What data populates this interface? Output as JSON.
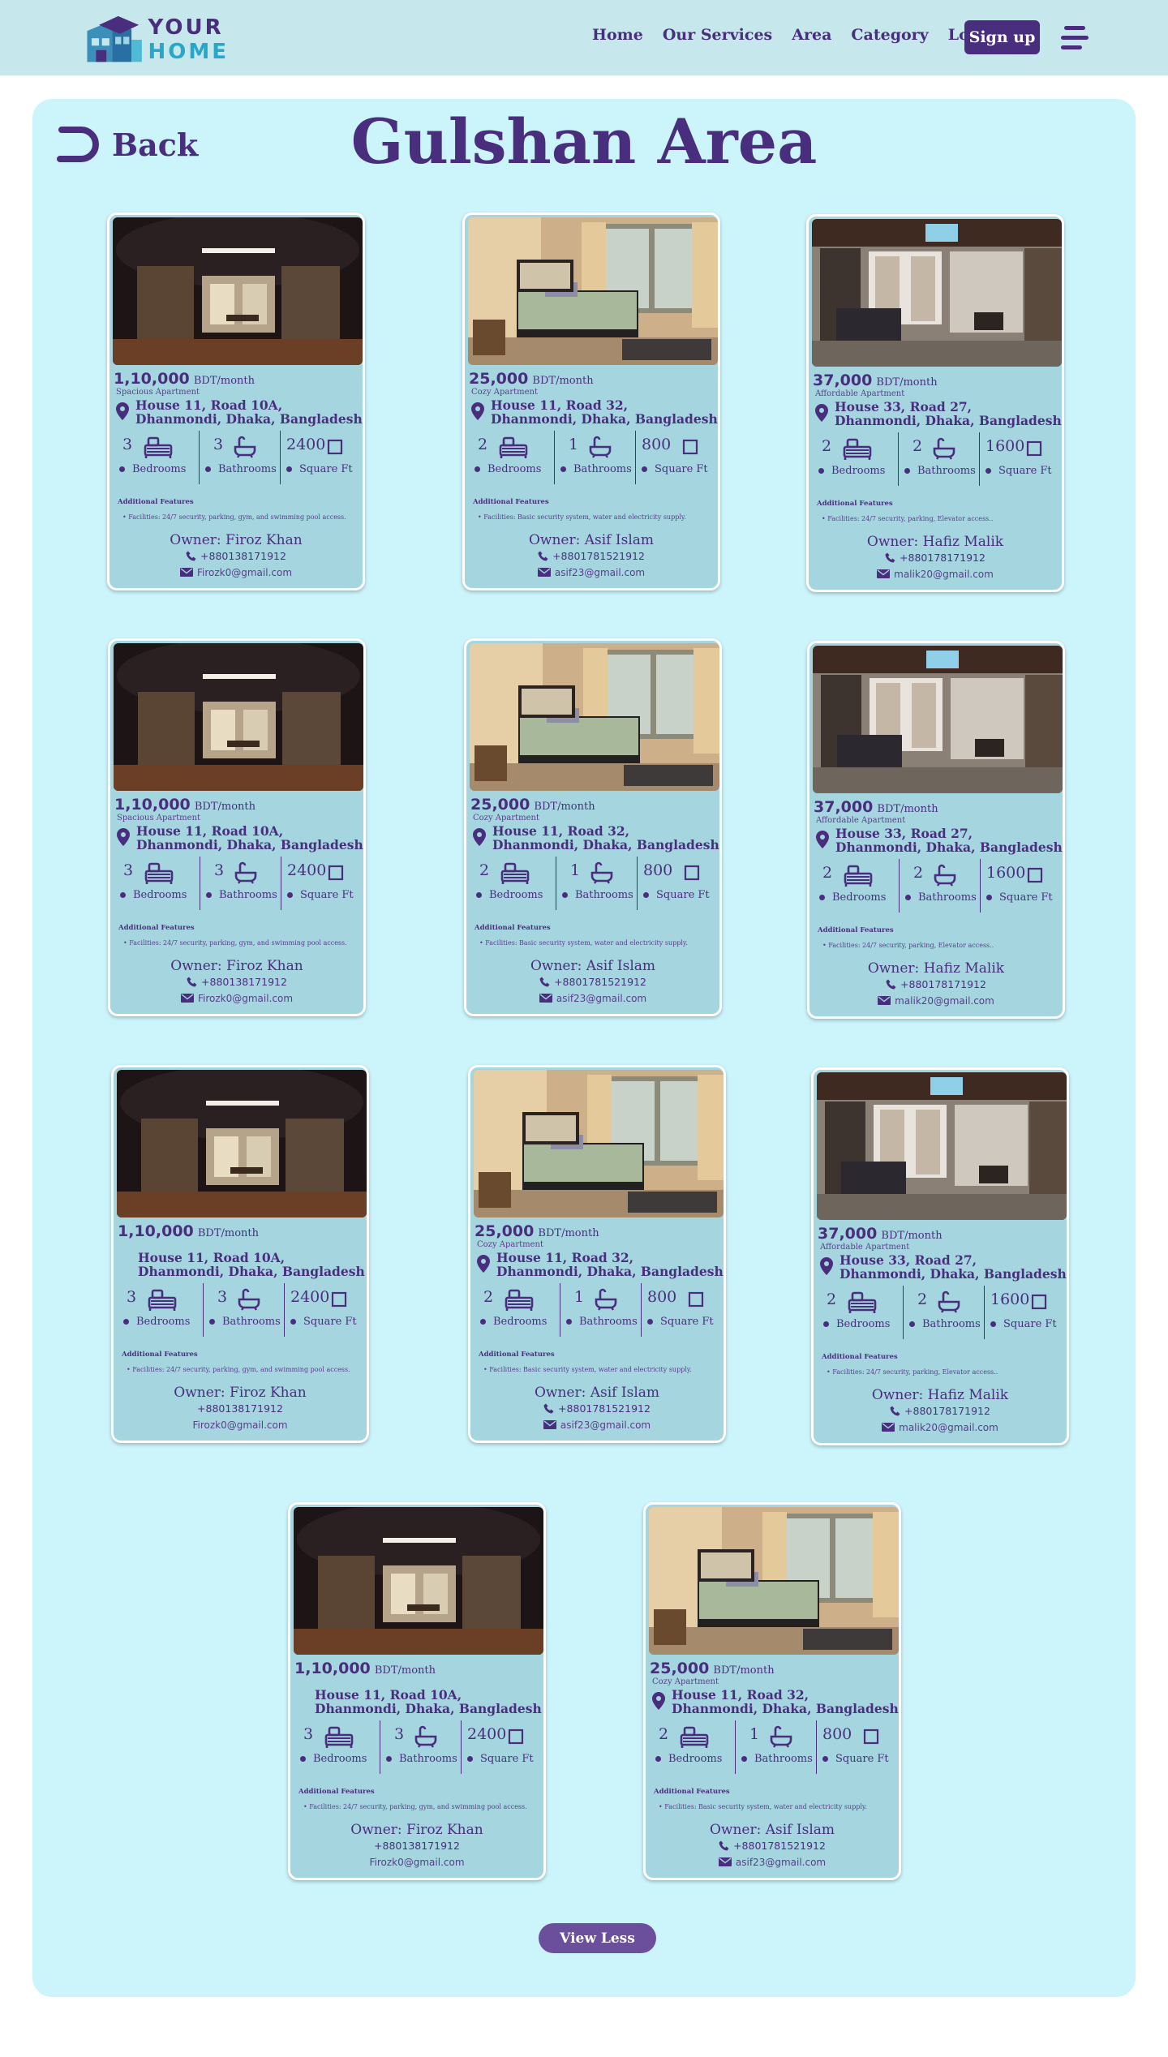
{
  "nav": {
    "logo_line1": "YOUR",
    "logo_line2": "HOME",
    "links": [
      "Home",
      "Our Services",
      "Area",
      "Category",
      "Login"
    ],
    "signup_label": "Sign up"
  },
  "back_label": "Back",
  "page_title": "Gulshan Area",
  "labels": {
    "per_month": "BDT/month",
    "bedrooms": "Bedrooms",
    "bathrooms": "Bathrooms",
    "square_ft": "Square Ft",
    "additional_features": "Additional Features"
  },
  "cards": [
    {
      "variant": "a",
      "price": "1,10,000",
      "type": "Spacious Apartment",
      "address": "House 11, Road 10A, Dhanmondi, Dhaka, Bangladesh",
      "bedrooms": "3",
      "bathrooms": "3",
      "sqft": "2400",
      "features": "Facilities: 24/7 security, parking, gym, and swimming pool access.",
      "owner": "Owner: Firoz Khan",
      "phone": "+880138171912",
      "email": "Firozk0@gmail.com"
    },
    {
      "variant": "b",
      "price": "25,000",
      "type": "Cozy Apartment",
      "address": "House 11, Road 32, Dhanmondi, Dhaka, Bangladesh",
      "bedrooms": "2",
      "bathrooms": "1",
      "sqft": "800",
      "features": "Facilities: Basic security system, water and electricity supply.",
      "owner": "Owner: Asif Islam",
      "phone": "+8801781521912",
      "email": "asif23@gmail.com"
    },
    {
      "variant": "c",
      "price": "37,000",
      "type": "Affordable Apartment",
      "address": "House 33, Road 27, Dhanmondi, Dhaka, Bangladesh",
      "bedrooms": "2",
      "bathrooms": "2",
      "sqft": "1600",
      "features": "Facilities: 24/7 security, parking, Elevator access..",
      "owner": "Owner: Hafiz Malik",
      "phone": "+880178171912",
      "email": "malik20@gmail.com"
    },
    {
      "variant": "a",
      "price": "1,10,000",
      "type": "Spacious Apartment",
      "address": "House 11, Road 10A, Dhanmondi, Dhaka, Bangladesh",
      "bedrooms": "3",
      "bathrooms": "3",
      "sqft": "2400",
      "features": "Facilities: 24/7 security, parking, gym, and swimming pool access.",
      "owner": "Owner: Firoz Khan",
      "phone": "+880138171912",
      "email": "Firozk0@gmail.com"
    },
    {
      "variant": "b",
      "price": "25,000",
      "type": "Cozy Apartment",
      "address": "House 11, Road 32, Dhanmondi, Dhaka, Bangladesh",
      "bedrooms": "2",
      "bathrooms": "1",
      "sqft": "800",
      "features": "Facilities: Basic security system, water and electricity supply.",
      "owner": "Owner: Asif Islam",
      "phone": "+8801781521912",
      "email": "asif23@gmail.com"
    },
    {
      "variant": "c",
      "price": "37,000",
      "type": "Affordable Apartment",
      "address": "House 33, Road 27, Dhanmondi, Dhaka, Bangladesh",
      "bedrooms": "2",
      "bathrooms": "2",
      "sqft": "1600",
      "features": "Facilities: 24/7 security, parking, Elevator access..",
      "owner": "Owner: Hafiz Malik",
      "phone": "+880178171912",
      "email": "malik20@gmail.com"
    },
    {
      "variant": "a",
      "price": "1,10,000",
      "type": "",
      "address": "House 11, Road 10A, Dhanmondi, Dhaka, Bangladesh",
      "bedrooms": "3",
      "bathrooms": "3",
      "sqft": "2400",
      "features": "Facilities: 24/7 security, parking, gym, and swimming pool access.",
      "owner": "Owner: Firoz Khan",
      "phone": "+880138171912",
      "email": "Firozk0@gmail.com",
      "plain": true
    },
    {
      "variant": "b",
      "price": "25,000",
      "type": "Cozy Apartment",
      "address": "House 11, Road 32, Dhanmondi, Dhaka, Bangladesh",
      "bedrooms": "2",
      "bathrooms": "1",
      "sqft": "800",
      "features": "Facilities: Basic security system, water and electricity supply.",
      "owner": "Owner: Asif Islam",
      "phone": "+8801781521912",
      "email": "asif23@gmail.com"
    },
    {
      "variant": "c",
      "price": "37,000",
      "type": "Affordable Apartment",
      "address": "House 33, Road 27, Dhanmondi, Dhaka, Bangladesh",
      "bedrooms": "2",
      "bathrooms": "2",
      "sqft": "1600",
      "features": "Facilities: 24/7 security, parking, Elevator access..",
      "owner": "Owner: Hafiz Malik",
      "phone": "+880178171912",
      "email": "malik20@gmail.com"
    },
    {
      "variant": "a",
      "price": "1,10,000",
      "type": "",
      "address": "House 11, Road 10A, Dhanmondi, Dhaka, Bangladesh",
      "bedrooms": "3",
      "bathrooms": "3",
      "sqft": "2400",
      "features": "Facilities: 24/7 security, parking, gym, and swimming pool access.",
      "owner": "Owner: Firoz Khan",
      "phone": "+880138171912",
      "email": "Firozk0@gmail.com",
      "plain": true
    },
    {
      "variant": "b",
      "price": "25,000",
      "type": "Cozy Apartment",
      "address": "House 11, Road 32, Dhanmondi, Dhaka, Bangladesh",
      "bedrooms": "2",
      "bathrooms": "1",
      "sqft": "800",
      "features": "Facilities: Basic security system, water and electricity supply.",
      "owner": "Owner: Asif Islam",
      "phone": "+8801781521912",
      "email": "asif23@gmail.com"
    }
  ],
  "view_less_label": "View Less",
  "colors": {
    "primary": "#4a2e7e",
    "accent": "#27a8c8",
    "panel": "#ccf4fb",
    "card": "#a5d6e0",
    "nav": "#c6e8ec"
  }
}
